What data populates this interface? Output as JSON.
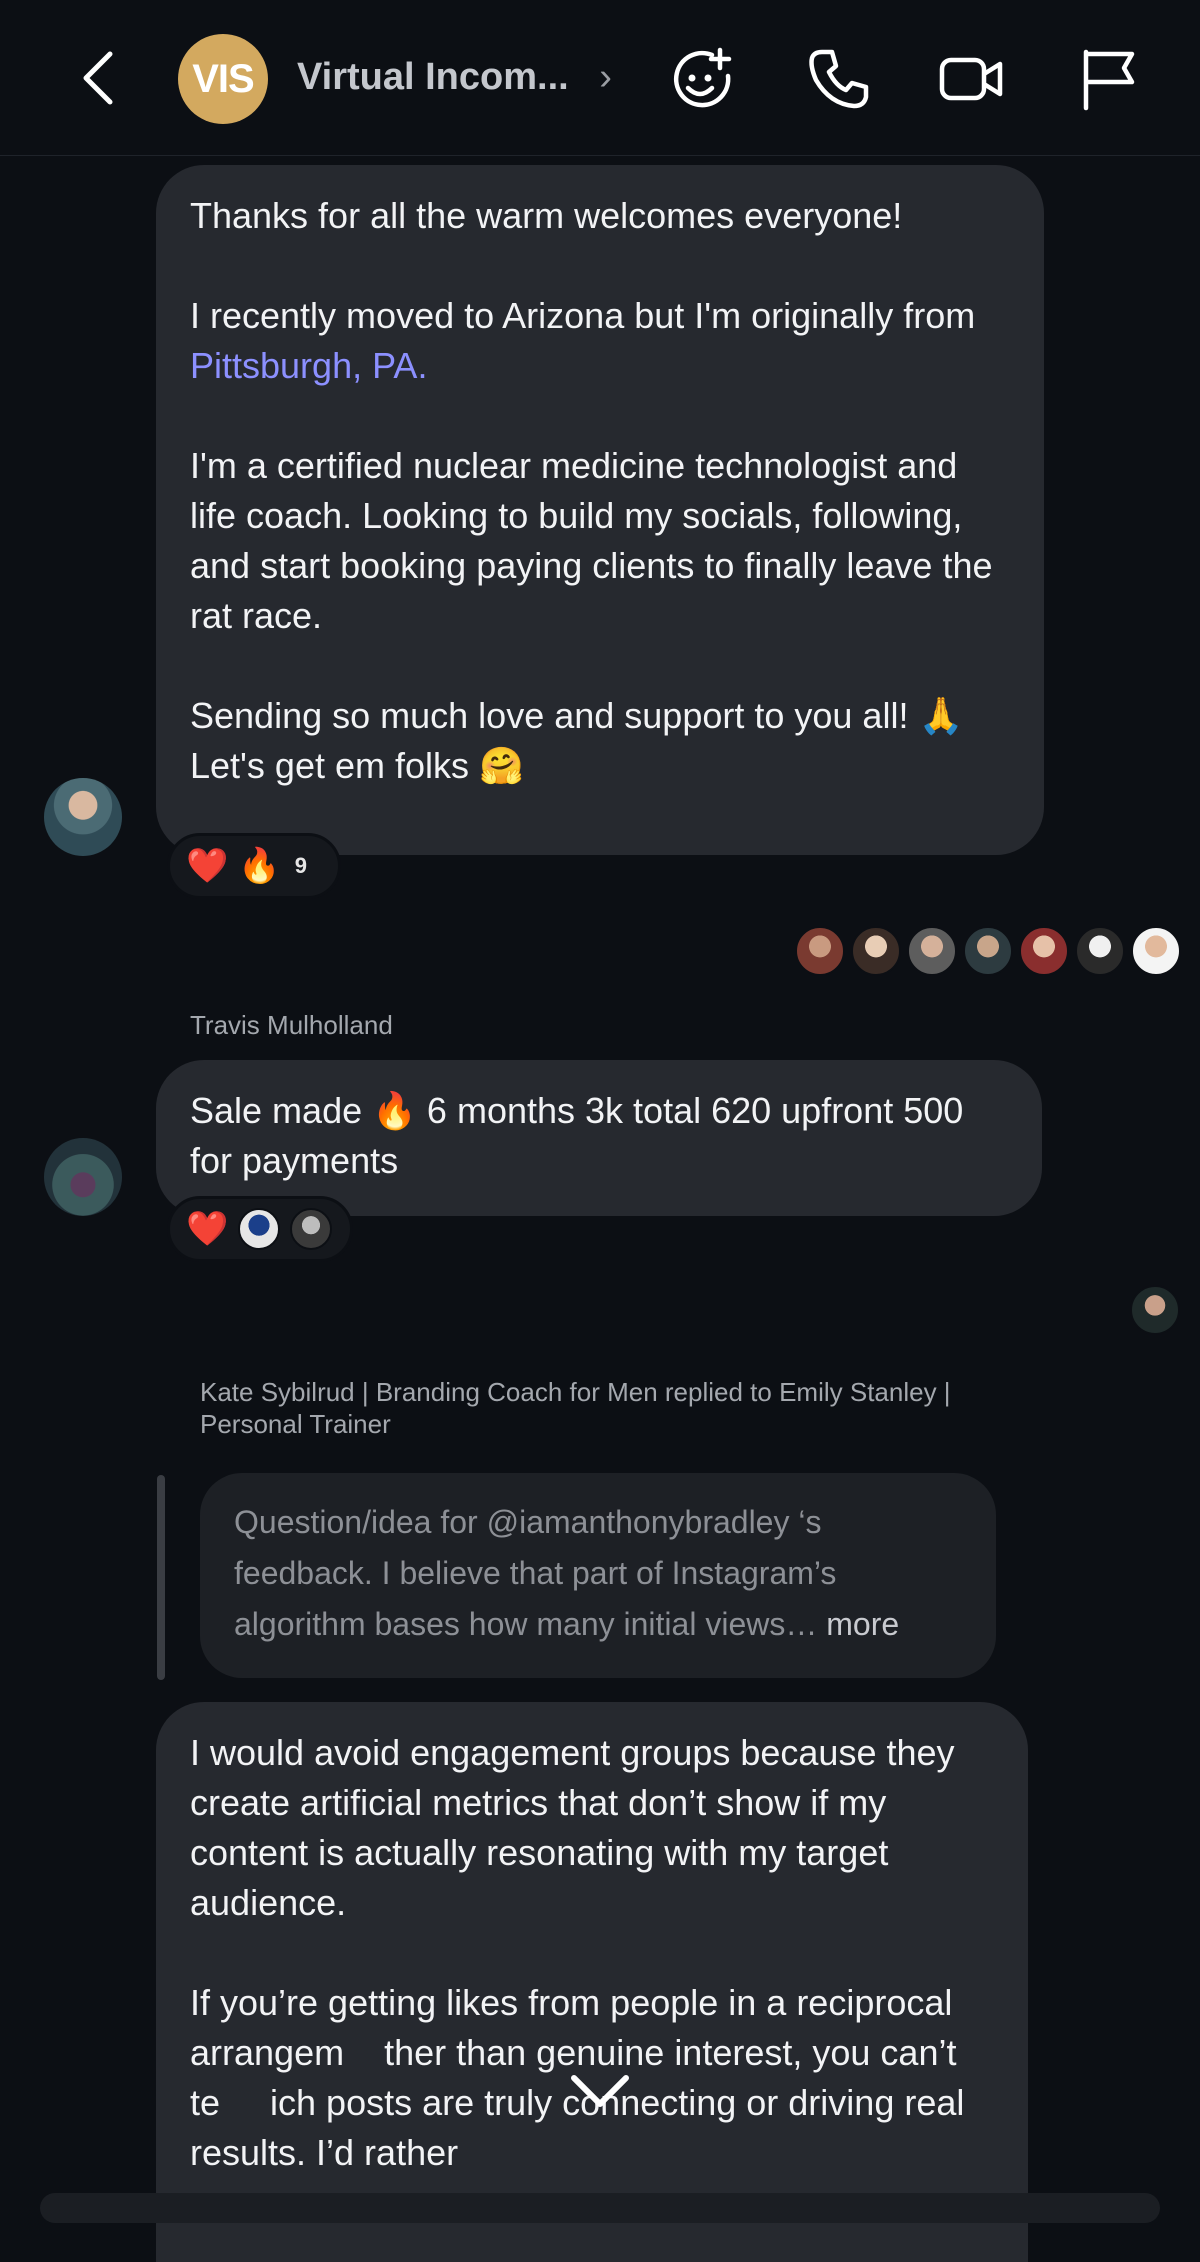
{
  "header": {
    "avatar_text": "VIS",
    "group_name": "Virtual Incom...",
    "chevron": "›",
    "icons": [
      "back-icon",
      "add-sticker-icon",
      "phone-icon",
      "video-icon",
      "flag-icon"
    ]
  },
  "messages": [
    {
      "paragraphs": [
        {
          "text": "Thanks for all the warm welcomes everyone!"
        },
        {
          "text": "I recently moved to Arizona but I'm originally from ",
          "link": "Pittsburgh, PA."
        },
        {
          "text": "I'm a certified nuclear medicine technologist and life coach. Looking to build my socials, following, and start booking paying clients to finally leave the rat race."
        },
        {
          "text": "Sending so much love and support to you all! 🙏 Let's get em folks 🤗"
        }
      ],
      "reactions": {
        "emojis": [
          "❤️",
          "🔥"
        ],
        "count": "9"
      }
    },
    {
      "sender": "Travis Mulholland",
      "text": "Sale made 🔥 6 months 3k total 620 upfront 500 for payments",
      "reactions": {
        "emojis": [
          "❤️"
        ]
      }
    }
  ],
  "reply": {
    "note": "Kate Sybilrud | Branding Coach for Men replied to Emily Stanley | Personal Trainer",
    "quoted_text": "Question/idea for @iamanthonybradley ‘s feedback. I believe that part of Instagram’s algorithm bases how many initial views…",
    "quoted_more": "more",
    "paragraph1": "I would avoid engagement groups because they create artificial metrics that don’t show if my content is actually resonating with my target audience.",
    "paragraph2": "If you’re getting likes from people in a reciprocal arrangem    ther than genuine interest, you can’t te     ich posts are truly connecting or driving real results. I’d rather"
  },
  "colors": {
    "background": "#0c0f14",
    "bubble": "#26292f",
    "link": "#8c90ff",
    "group_avatar": "#d3a95f"
  }
}
